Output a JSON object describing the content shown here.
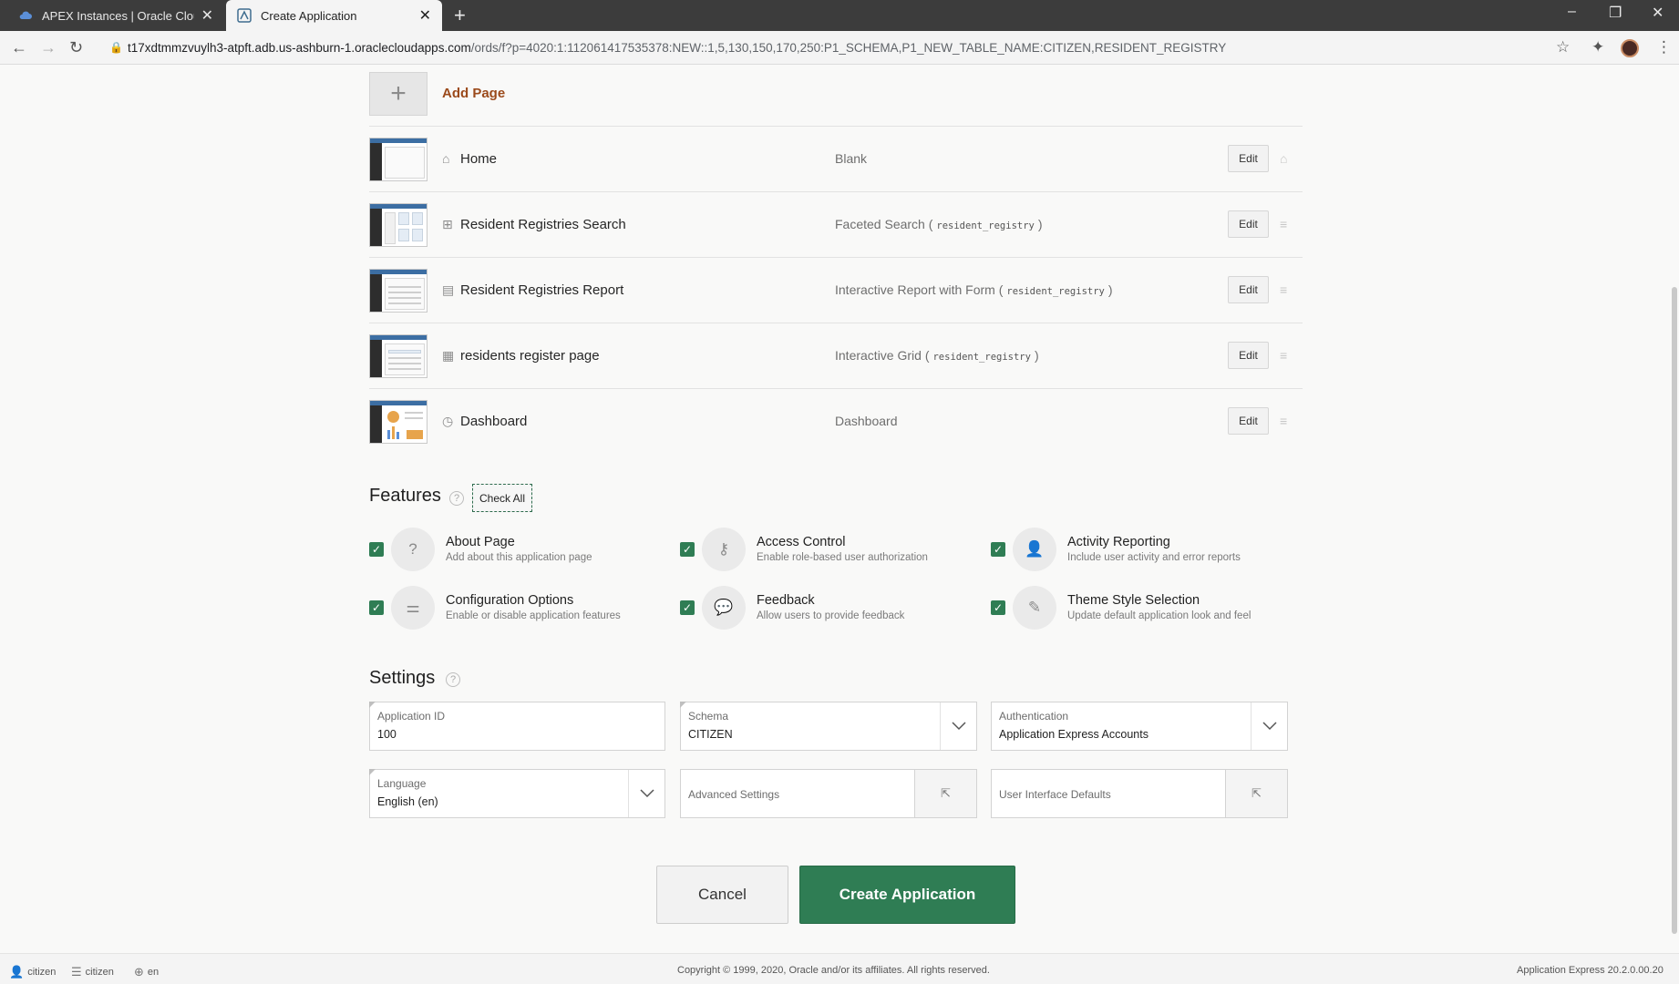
{
  "browser": {
    "tabs": [
      {
        "label": "APEX Instances | Oracle Cloud Inf",
        "icon": "cloud-icon"
      },
      {
        "label": "Create Application",
        "icon": "apex-icon"
      }
    ],
    "url_host": "t17xdtmmzvuylh3-atpft.adb.us-ashburn-1.oraclecloudapps.com",
    "url_path": "/ords/f?p=4020:1:112061417535378:NEW::1,5,130,150,170,250:P1_SCHEMA,P1_NEW_TABLE_NAME:CITIZEN,RESIDENT_REGISTRY"
  },
  "add_page_label": "Add Page",
  "pages": [
    {
      "name": "Home",
      "type": "Blank",
      "source": "",
      "edit": "Edit",
      "icon": "home-icon"
    },
    {
      "name": "Resident Registries Search",
      "type": "Faceted Search (",
      "source": "resident_registry",
      "edit": "Edit",
      "icon": "search-report-icon"
    },
    {
      "name": "Resident Registries Report",
      "type": "Interactive Report with Form (",
      "source": "resident_registry",
      "edit": "Edit",
      "icon": "report-icon"
    },
    {
      "name": "residents register page",
      "type": "Interactive Grid (",
      "source": "resident_registry",
      "edit": "Edit",
      "icon": "grid-icon"
    },
    {
      "name": "Dashboard",
      "type": "Dashboard",
      "source": "",
      "edit": "Edit",
      "icon": "dashboard-icon"
    }
  ],
  "features": {
    "title": "Features",
    "check_all": "Check All",
    "items": [
      {
        "name": "About Page",
        "desc": "Add about this application page",
        "icon": "question-icon",
        "checked": true
      },
      {
        "name": "Access Control",
        "desc": "Enable role-based user authorization",
        "icon": "key-icon",
        "checked": true
      },
      {
        "name": "Activity Reporting",
        "desc": "Include user activity and error reports",
        "icon": "user-lock-icon",
        "checked": true
      },
      {
        "name": "Configuration Options",
        "desc": "Enable or disable application features",
        "icon": "sliders-icon",
        "checked": true
      },
      {
        "name": "Feedback",
        "desc": "Allow users to provide feedback",
        "icon": "comment-icon",
        "checked": true
      },
      {
        "name": "Theme Style Selection",
        "desc": "Update default application look and feel",
        "icon": "brush-icon",
        "checked": true
      }
    ]
  },
  "settings": {
    "title": "Settings",
    "app_id": {
      "label": "Application ID",
      "value": "100"
    },
    "schema": {
      "label": "Schema",
      "value": "CITIZEN"
    },
    "auth": {
      "label": "Authentication",
      "value": "Application Express Accounts"
    },
    "language": {
      "label": "Language",
      "value": "English (en)"
    },
    "advanced": {
      "label": "Advanced Settings"
    },
    "ui_defaults": {
      "label": "User Interface Defaults"
    }
  },
  "buttons": {
    "cancel": "Cancel",
    "create": "Create Application"
  },
  "footer": {
    "user": "citizen",
    "workspace": "citizen",
    "lang": "en",
    "copyright": "Copyright © 1999, 2020, Oracle and/or its affiliates. All rights reserved.",
    "version": "Application Express 20.2.0.00.20"
  },
  "colors": {
    "accent": "#2f7d54",
    "add_page": "#9b4a1b"
  }
}
